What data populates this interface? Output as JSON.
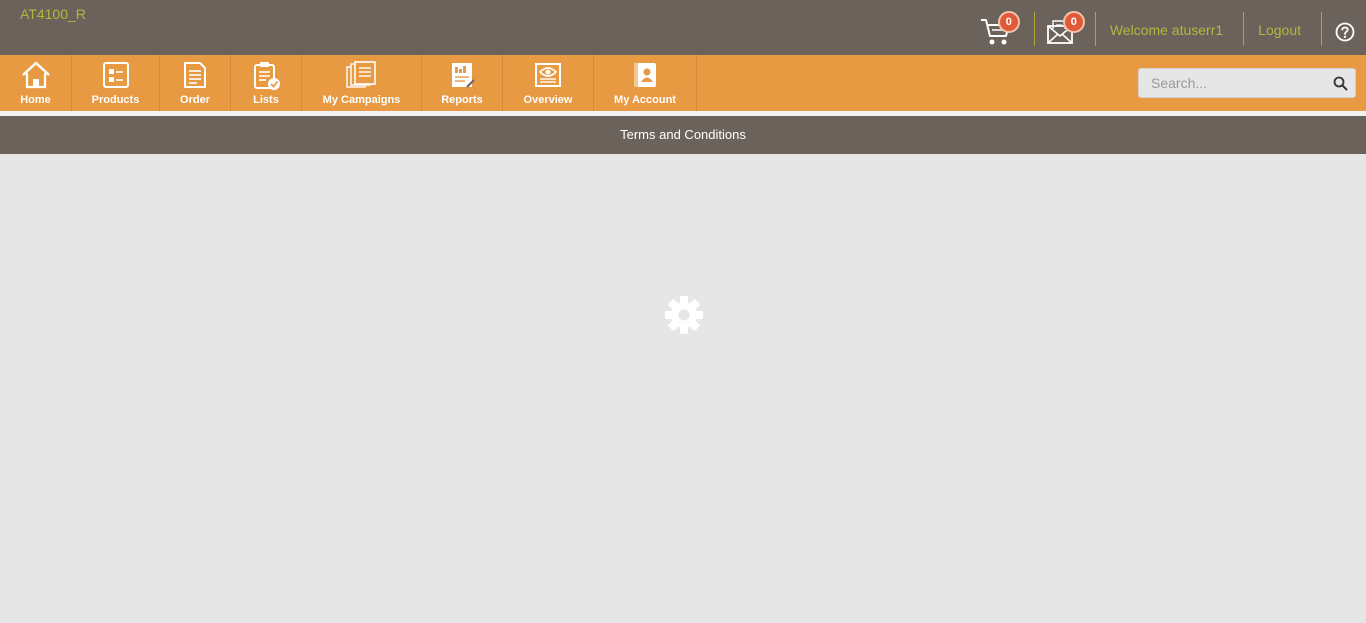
{
  "header": {
    "site_code": "AT4100_R",
    "cart_count": "0",
    "messages_count": "0",
    "welcome_text": "Welcome atuserr1",
    "logout_label": "Logout"
  },
  "nav": {
    "items": [
      {
        "label": "Home",
        "icon": "home-icon"
      },
      {
        "label": "Products",
        "icon": "products-icon"
      },
      {
        "label": "Order",
        "icon": "order-icon"
      },
      {
        "label": "Lists",
        "icon": "lists-icon"
      },
      {
        "label": "My Campaigns",
        "icon": "campaigns-icon"
      },
      {
        "label": "Reports",
        "icon": "reports-icon"
      },
      {
        "label": "Overview",
        "icon": "overview-icon"
      },
      {
        "label": "My Account",
        "icon": "account-icon"
      }
    ]
  },
  "search": {
    "placeholder": "Search...",
    "value": ""
  },
  "page": {
    "title": "Terms and Conditions",
    "loading_icon": "gear-icon"
  },
  "colors": {
    "topbar": "#6b625c",
    "nav": "#e89a43",
    "accent_text": "#b3b83a",
    "badge": "#e05a3a",
    "content_bg": "#e6e6e6"
  }
}
